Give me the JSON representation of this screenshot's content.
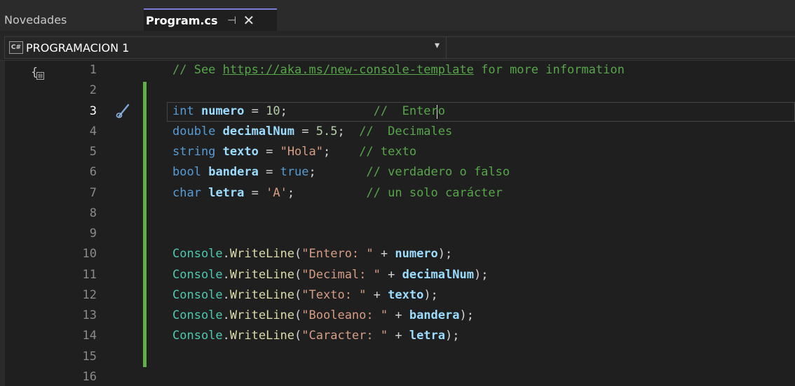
{
  "tabs": [
    {
      "label": "Novedades",
      "active": false
    },
    {
      "label": "Program.cs",
      "active": true,
      "pin_icon": "pin-icon",
      "close_icon": "close-icon"
    }
  ],
  "project": {
    "label": "PROGRAMACION 1",
    "icon": "csharp-project-icon"
  },
  "colors": {
    "gutter_change_bar": "#5fb048",
    "active_tab_accent": "#7a7dd8",
    "comment": "#57a64a",
    "keyword": "#569cd6",
    "string": "#d69d85"
  },
  "editor": {
    "line_numbers": [
      "1",
      "2",
      "3",
      "4",
      "5",
      "6",
      "7",
      "8",
      "9",
      "10",
      "11",
      "12",
      "13",
      "14",
      "15",
      "16"
    ],
    "current_line": "3",
    "lines": [
      {
        "parts": [
          "// See ",
          "https://aka.ms/new-console-template",
          " for more information"
        ]
      },
      {
        "parts": []
      },
      {
        "parts": [
          "int",
          " ",
          "numero",
          " = ",
          "10",
          ";",
          "            //  Entero"
        ]
      },
      {
        "parts": [
          "double",
          " ",
          "decimalNum",
          " = ",
          "5.5",
          ";",
          "  //  Decimales"
        ]
      },
      {
        "parts": [
          "string",
          " ",
          "texto",
          " = ",
          "\"Hola\"",
          ";",
          "    // texto"
        ]
      },
      {
        "parts": [
          "bool",
          " ",
          "bandera",
          " = ",
          "true",
          ";",
          "       // verdadero o falso"
        ]
      },
      {
        "parts": [
          "char",
          " ",
          "letra",
          " = ",
          "'A'",
          ";",
          "          // un solo carácter"
        ]
      },
      {
        "parts": []
      },
      {
        "parts": []
      },
      {
        "parts": [
          "Console",
          ".",
          "WriteLine",
          "(",
          "\"Entero: \"",
          " + ",
          "numero",
          ");"
        ]
      },
      {
        "parts": [
          "Console",
          ".",
          "WriteLine",
          "(",
          "\"Decimal: \"",
          " + ",
          "decimalNum",
          ");"
        ]
      },
      {
        "parts": [
          "Console",
          ".",
          "WriteLine",
          "(",
          "\"Texto: \"",
          " + ",
          "texto",
          ");"
        ]
      },
      {
        "parts": [
          "Console",
          ".",
          "WriteLine",
          "(",
          "\"Booleano: \"",
          " + ",
          "bandera",
          ");"
        ]
      },
      {
        "parts": [
          "Console",
          ".",
          "WriteLine",
          "(",
          "\"Caracter: \"",
          " + ",
          "letra",
          ");"
        ]
      },
      {
        "parts": []
      },
      {
        "parts": []
      }
    ]
  }
}
